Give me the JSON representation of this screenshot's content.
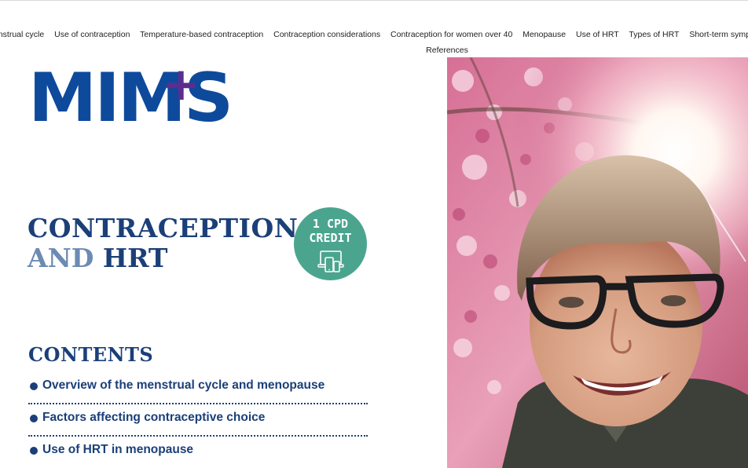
{
  "nav": {
    "items": [
      "enstrual cycle",
      "Use of contraception",
      "Temperature-based contraception",
      "Contraception considerations",
      "Contraception for women over 40",
      "Menopause",
      "Use of HRT",
      "Types of HRT",
      "Short-term symptom manageme"
    ],
    "references": "References"
  },
  "logo": {
    "text": "MIMS",
    "plus": "+"
  },
  "title": {
    "line1": "CONTRACEPTION",
    "and": "AND",
    "hrt": "HRT"
  },
  "badge": {
    "line1": "1 CPD",
    "line2": "CREDIT",
    "icon": "devices-icon"
  },
  "contents": {
    "heading": "CONTENTS",
    "items": [
      "Overview of the menstrual cycle and menopause",
      "Factors affecting contraceptive choice",
      "Use of HRT in menopause"
    ]
  },
  "hero": {
    "alt_subject": "smiling woman with glasses",
    "colors": {
      "blossom": "#d7709a",
      "sky": "#f6efe8",
      "hair": "#8c6f5b",
      "skin": "#d9a58a",
      "jacket": "#3d4038"
    }
  },
  "colors": {
    "brand_blue": "#0e4a9b",
    "brand_purple": "#5b2d8e",
    "navy": "#1b3f78",
    "light_blue": "#6c8bb3",
    "badge_green": "#4ba58e"
  }
}
